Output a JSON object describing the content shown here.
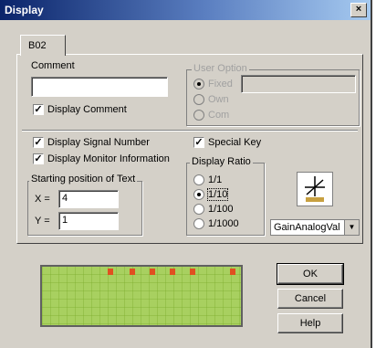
{
  "window": {
    "title": "Display",
    "close_glyph": "×"
  },
  "tab": {
    "label": "B02"
  },
  "comment": {
    "label": "Comment",
    "value": ""
  },
  "display_comment": {
    "label": "Display Comment",
    "checked": true
  },
  "user_option": {
    "label": "User Option",
    "radios": [
      "Fixed",
      "Own",
      "Com"
    ]
  },
  "display_signal_number": {
    "label": "Display Signal Number",
    "checked": true
  },
  "display_monitor_information": {
    "label": "Display Monitor Information",
    "checked": true
  },
  "special_key": {
    "label": "Special Key",
    "checked": true
  },
  "start_position": {
    "label": "Starting position of Text",
    "x_label": "X =",
    "x_value": "4",
    "y_label": "Y =",
    "y_value": "1"
  },
  "display_ratio": {
    "label": "Display Ratio",
    "options": [
      "1/1",
      "1/10",
      "1/100",
      "1/1000"
    ],
    "selected": "1/10"
  },
  "gain_select": {
    "value": "GainAnalogVal"
  },
  "buttons": {
    "ok": "OK",
    "cancel": "Cancel",
    "help": "Help"
  },
  "colors": {
    "lcd_green": "#a8d060",
    "marker": "#e05020",
    "title_blue": "#0a246a"
  }
}
